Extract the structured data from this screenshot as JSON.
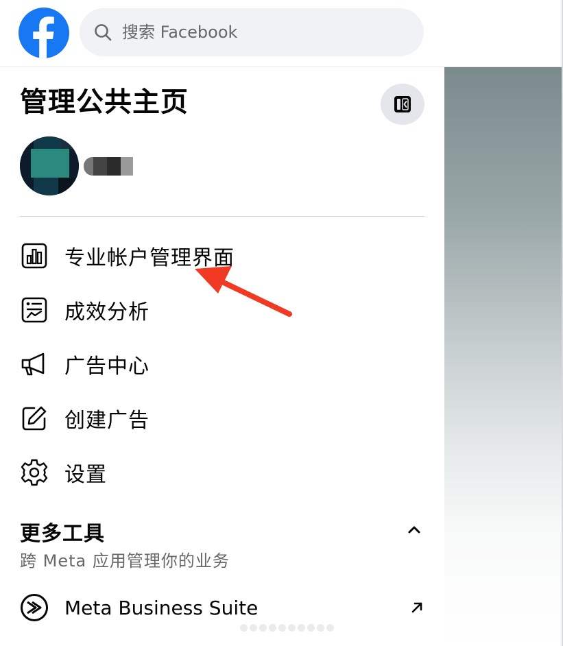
{
  "header": {
    "search_placeholder": "搜索 Facebook",
    "brand_color": "#1877f2"
  },
  "panel": {
    "title": "管理公共主页",
    "collapse_icon": "sidebar-toggle-icon"
  },
  "menu": {
    "items": [
      {
        "label": "专业帐户管理界面",
        "icon": "dashboard-icon"
      },
      {
        "label": "成效分析",
        "icon": "insights-icon"
      },
      {
        "label": "广告中心",
        "icon": "megaphone-icon"
      },
      {
        "label": "创建广告",
        "icon": "edit-icon"
      },
      {
        "label": "设置",
        "icon": "gear-icon"
      }
    ]
  },
  "more_tools": {
    "heading": "更多工具",
    "subheading": "跨 Meta 应用管理你的业务",
    "items": [
      {
        "label": "Meta Business Suite",
        "icon": "meta-business-suite-icon"
      }
    ]
  },
  "annotation": {
    "arrow_color": "#f03a23"
  }
}
